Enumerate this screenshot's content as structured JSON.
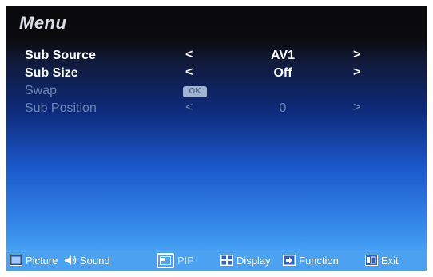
{
  "menu": {
    "title": "Menu",
    "rows": [
      {
        "label": "Sub Source",
        "left_arrow": "<",
        "value": "AV1",
        "right_arrow": ">"
      },
      {
        "label": "Sub Size",
        "left_arrow": "<",
        "value": "Off",
        "right_arrow": ">"
      },
      {
        "label": "Swap",
        "badge": "OK"
      },
      {
        "label": "Sub Position",
        "left_arrow": "<",
        "value": "0",
        "right_arrow": ">"
      }
    ]
  },
  "tabs": [
    {
      "label": "Picture",
      "icon": "picture-icon"
    },
    {
      "label": "Sound",
      "icon": "speaker-icon"
    },
    {
      "label": "PIP",
      "icon": "pip-icon",
      "selected": true
    },
    {
      "label": "Display",
      "icon": "display-grid-icon"
    },
    {
      "label": "Function",
      "icon": "function-icon"
    },
    {
      "label": "Exit",
      "icon": "exit-icon"
    }
  ],
  "colors": {
    "active_text": "#ffffff",
    "disabled_text": "#6c86b0",
    "bottom_bar": "#4aa2f1"
  }
}
